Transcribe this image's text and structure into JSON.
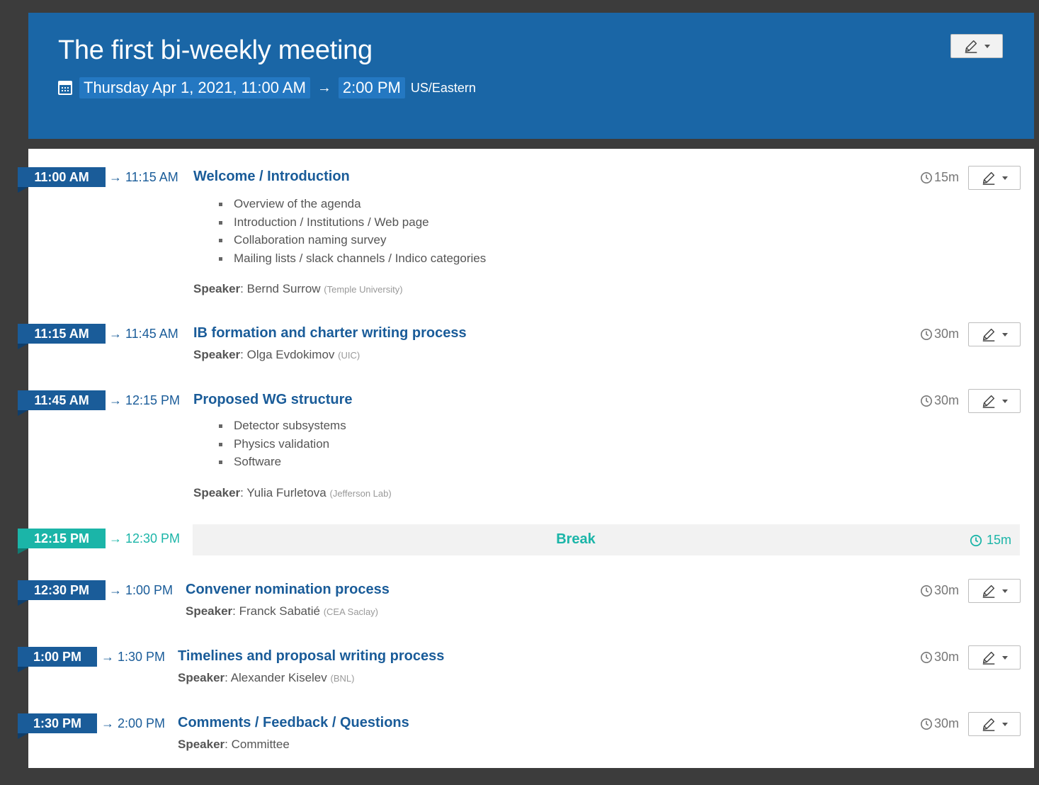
{
  "event": {
    "title": "The first bi-weekly meeting",
    "start": "Thursday Apr 1, 2021, 11:00 AM",
    "arrow": "→",
    "end": "2:00 PM",
    "timezone": "US/Eastern"
  },
  "entries": [
    {
      "start": "11:00 AM",
      "end": "→ 11:15 AM",
      "title": "Welcome / Introduction",
      "duration": "15m",
      "bullets": [
        "Overview of the agenda",
        "Introduction / Institutions / Web page",
        "Collaboration naming survey",
        "Mailing lists / slack channels / Indico categories"
      ],
      "speaker_label": "Speaker",
      "speaker": "Bernd Surrow",
      "affiliation": "(Temple University)"
    },
    {
      "start": "11:15 AM",
      "end": "→ 11:45 AM",
      "title": "IB formation and charter writing process",
      "duration": "30m",
      "speaker_label": "Speaker",
      "speaker": "Olga Evdokimov",
      "affiliation": "(UIC)"
    },
    {
      "start": "11:45 AM",
      "end": "→ 12:15 PM",
      "title": "Proposed WG structure",
      "duration": "30m",
      "bullets": [
        "Detector subsystems",
        "Physics validation",
        "Software"
      ],
      "speaker_label": "Speaker",
      "speaker": "Yulia Furletova",
      "affiliation": "(Jefferson Lab)"
    },
    {
      "start": "12:15 PM",
      "end": "→ 12:30 PM",
      "title": "Break",
      "duration": "15m"
    },
    {
      "start": "12:30 PM",
      "end": "→ 1:00 PM",
      "title": "Convener nomination process",
      "duration": "30m",
      "speaker_label": "Speaker",
      "speaker": "Franck Sabatié",
      "affiliation": "(CEA Saclay)"
    },
    {
      "start": "1:00 PM",
      "end": "→ 1:30 PM",
      "title": "Timelines and proposal writing process",
      "duration": "30m",
      "speaker_label": "Speaker",
      "speaker": "Alexander Kiselev",
      "affiliation": "(BNL)"
    },
    {
      "start": "1:30 PM",
      "end": "→ 2:00 PM",
      "title": "Comments / Feedback / Questions",
      "duration": "30m",
      "speaker_label": "Speaker",
      "speaker": "Committee"
    }
  ],
  "icons": {
    "calendar": "calendar-icon",
    "edit": "pencil-icon",
    "clock": "clock-icon",
    "dropdown": "caret-down-icon"
  },
  "colors": {
    "header_bg": "#1a66a6",
    "primary": "#1a5c99",
    "break": "#1bb5a8"
  }
}
